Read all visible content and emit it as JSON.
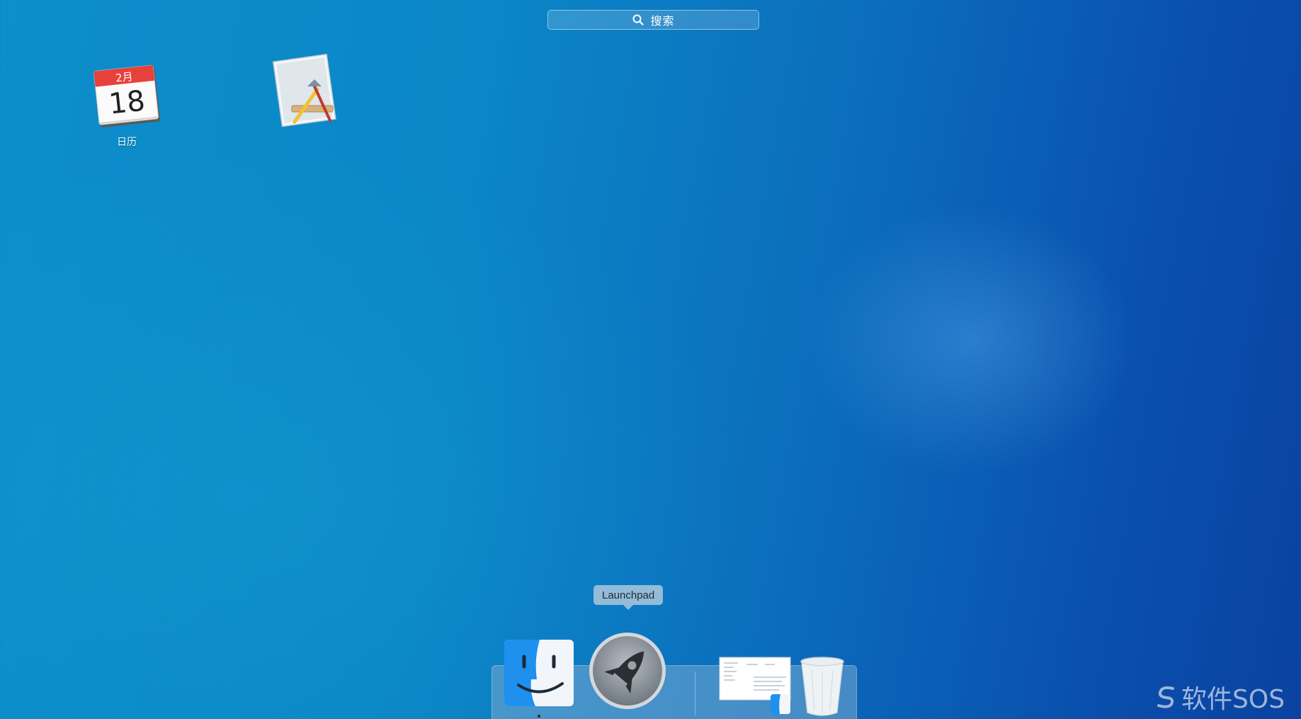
{
  "search": {
    "label": "搜索",
    "icon": "search-icon"
  },
  "apps": [
    {
      "name": "日历",
      "icon": "calendar-icon",
      "month": "2月",
      "day": "18"
    },
    {
      "name": "",
      "icon": "xcode-icon"
    }
  ],
  "dock": {
    "tooltip": "Launchpad",
    "items": [
      {
        "icon": "finder-icon",
        "running": true
      },
      {
        "icon": "launchpad-icon",
        "running": false
      },
      {
        "icon": "finder-window-thumbnail-icon",
        "running": false
      },
      {
        "icon": "trash-icon",
        "running": false
      }
    ]
  },
  "watermark": {
    "text": "软件SOS",
    "icon": "sos-logo-icon"
  },
  "colors": {
    "background_left": "#0c8fcb",
    "background_right": "#0a42a0",
    "calendar_red": "#e8403b",
    "finder_blue": "#1e90ee"
  }
}
